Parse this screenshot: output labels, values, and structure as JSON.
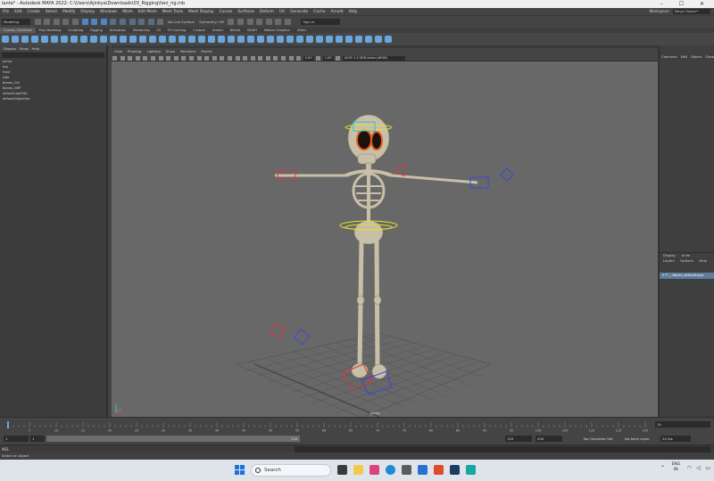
{
  "window": {
    "title": "lanta* - Autodesk MAYA 2022: C:\\Users\\Ajinkya\\Downloads\\03_Rigging\\fani_rig.mb",
    "controls": "–   ☐   ✕"
  },
  "menubar": {
    "items": [
      "File",
      "Edit",
      "Create",
      "Select",
      "Modify",
      "Display",
      "Windows",
      "Mesh",
      "Edit Mesh",
      "Mesh Tools",
      "Mesh Display",
      "Curves",
      "Surfaces",
      "Deform",
      "UV",
      "Generate",
      "Cache",
      "Arnold",
      "Help"
    ],
    "workspace_label": "Workspace :",
    "workspace_value": "Maya Classic*"
  },
  "statusline": {
    "mode": "Modeling",
    "live_surface": "No Live Surface",
    "symmetry": "Symmetry: Off",
    "sign_in": "Sign In"
  },
  "shelf": {
    "tabs": [
      "Curves / Surfaces",
      "Poly Modeling",
      "Sculpting",
      "Rigging",
      "Animation",
      "Rendering",
      "FX",
      "FX Caching",
      "Custom",
      "Arnold",
      "Bifrost",
      "MASH",
      "Motion Graphics",
      "XGen"
    ],
    "active_tab": 0
  },
  "outliner": {
    "menu": [
      "Display",
      "Show",
      "Help"
    ],
    "items": [
      "persp",
      "top",
      "front",
      "side",
      "Bones_Ctrl",
      "Bones_GRP",
      "defaultLightSet",
      "defaultObjectSet"
    ]
  },
  "viewport": {
    "menu": [
      "View",
      "Shading",
      "Lighting",
      "Show",
      "Renderer",
      "Panels"
    ],
    "exposure": "0.00",
    "gamma": "1.00",
    "colorspace": "ACES 1.0 SDR-video (sRGB)",
    "camera_label": "persp"
  },
  "channel_box": {
    "tabs": [
      "Channels",
      "Edit",
      "Object",
      "Show"
    ]
  },
  "layers": {
    "tabs": [
      "Display",
      "Anim"
    ],
    "menu": [
      "Layers",
      "Options",
      "Help"
    ],
    "row_label": "V  P  ⬚  Bones_defaultLayer"
  },
  "time_slider": {
    "ticks": [
      5,
      10,
      15,
      20,
      25,
      30,
      35,
      40,
      45,
      50,
      55,
      60,
      65,
      70,
      75,
      80,
      85,
      90,
      95,
      100,
      105,
      110,
      115,
      120
    ],
    "current_frame": "1",
    "current_frame_field": "19"
  },
  "range": {
    "start": "1",
    "playback_start": "1",
    "playback_end": "120",
    "end": "120",
    "anim_end": "200",
    "character_set": "No Character Set",
    "anim_layer": "No Anim Layer",
    "fps": "24 fps"
  },
  "cmdline": {
    "label": "MEL"
  },
  "helpline": {
    "text": "Select an object"
  },
  "taskbar": {
    "search": "Search",
    "lang_top": "ENG",
    "lang_bottom": "IN"
  },
  "colors": {
    "viewport_bg": "#686868",
    "bone": "#c8bfa9",
    "ctrl_red": "#d63a3a",
    "ctrl_blue": "#3b49d6",
    "ctrl_yellow": "#e3df2b",
    "ctrl_cyan": "#2fb7e3",
    "eye_orange": "#e85a1d"
  }
}
